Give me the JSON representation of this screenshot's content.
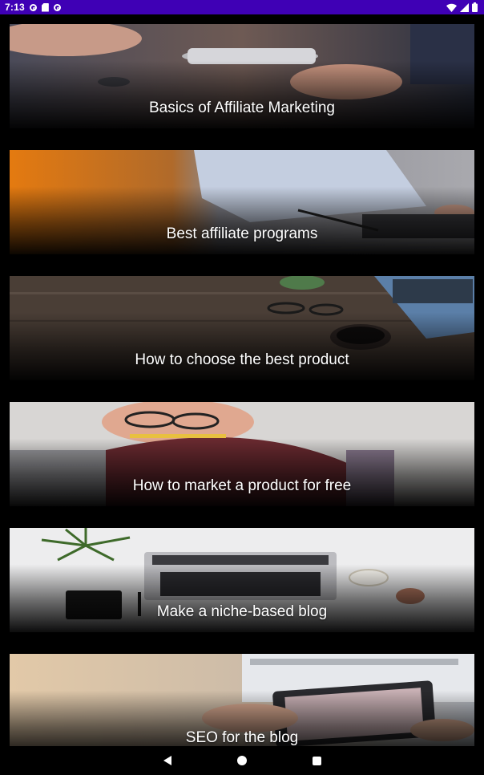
{
  "status_bar": {
    "time": "7:13",
    "icons": [
      "sync-ring-icon",
      "sd-card-icon",
      "sync-ring-icon",
      "wifi-icon",
      "signal-icon",
      "battery-icon"
    ]
  },
  "cards": [
    {
      "title": "Basics of Affiliate Marketing",
      "image": "hands-holding-phone-photo"
    },
    {
      "title": "Best affiliate programs",
      "image": "man-typing-laptop-photo"
    },
    {
      "title": "How to choose the best product",
      "image": "desk-glasses-coffee-laptop-photo"
    },
    {
      "title": "How to market a product for free",
      "image": "woman-biting-pencil-photo"
    },
    {
      "title": "Make a niche-based blog",
      "image": "laptop-plant-notebook-photo"
    },
    {
      "title": "SEO for the blog",
      "image": "hands-tablet-browsing-photo"
    }
  ],
  "navigation_bar": {
    "icons": [
      "back-icon",
      "home-icon",
      "recents-icon"
    ]
  }
}
